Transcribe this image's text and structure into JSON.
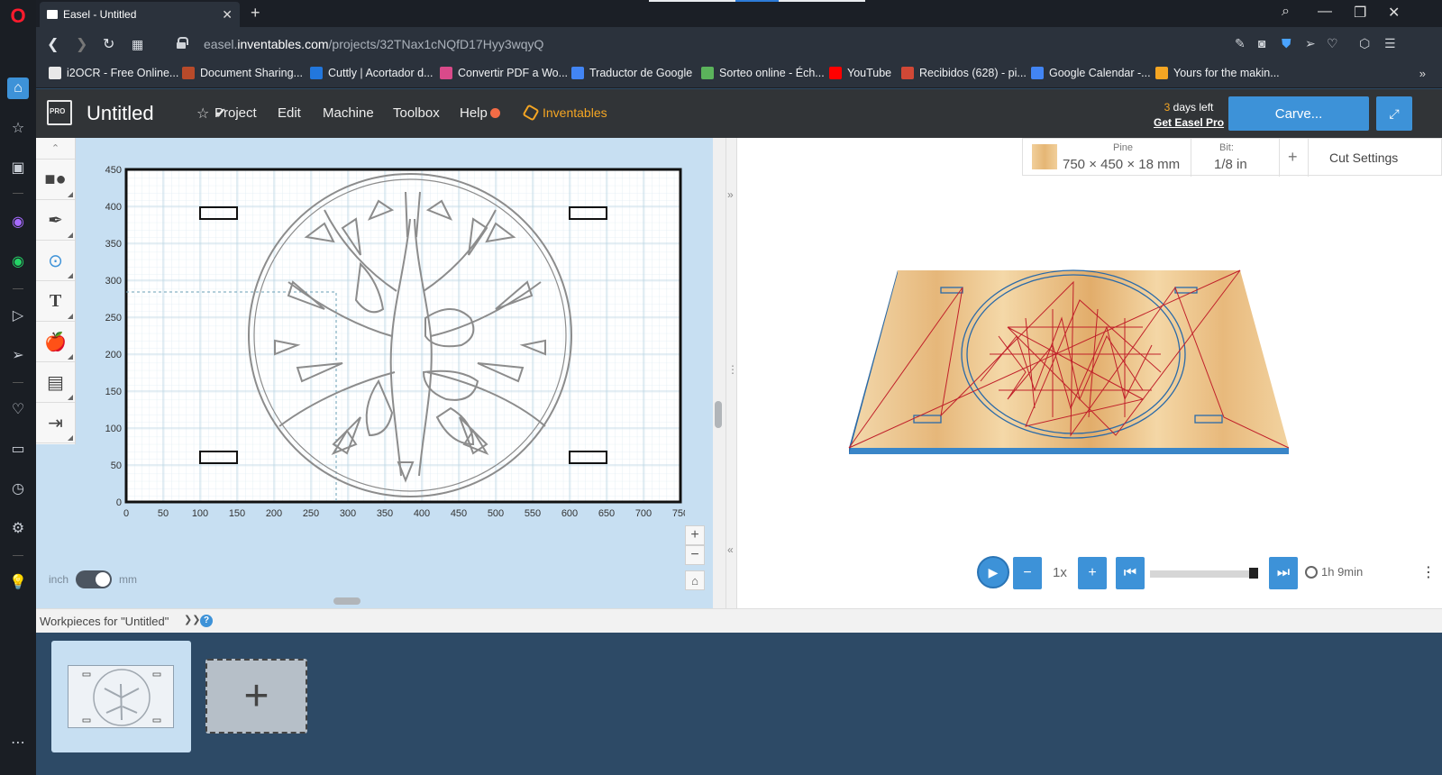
{
  "browser": {
    "tab_title": "Easel - Untitled",
    "url_prefix": "easel.",
    "url_domain": "inventables.com",
    "url_path": "/projects/32TNax1cNQfD17Hyy3wqyQ",
    "bookmarks": [
      {
        "label": "i2OCR - Free Online...",
        "color": "#e8e8e8"
      },
      {
        "label": "Document Sharing...",
        "color": "#b84a2a"
      },
      {
        "label": "Cuttly | Acortador d...",
        "color": "#2277dd"
      },
      {
        "label": "Convertir PDF a Wo...",
        "color": "#d94a8a"
      },
      {
        "label": "Traductor de Google",
        "color": "#4285f4"
      },
      {
        "label": "Sorteo online - Éch...",
        "color": "#5bb35b"
      },
      {
        "label": "YouTube",
        "color": "#ff0000"
      },
      {
        "label": "Recibidos (628) - pi...",
        "color": "#d14836"
      },
      {
        "label": "Google Calendar -...",
        "color": "#4285f4"
      },
      {
        "label": "Yours for the makin...",
        "color": "#f5a623"
      }
    ]
  },
  "easel": {
    "project_title": "Untitled",
    "menu": [
      "Project",
      "Edit",
      "Machine",
      "Toolbox",
      "Help"
    ],
    "inventables_label": "Inventables",
    "trial_days": "3",
    "trial_suffix": " days left",
    "get_pro": "Get Easel Pro",
    "carve_label": "Carve..."
  },
  "design": {
    "y_ticks": [
      "450",
      "400",
      "350",
      "300",
      "250",
      "200",
      "150",
      "100",
      "50",
      "0"
    ],
    "x_ticks": [
      "0",
      "50",
      "100",
      "150",
      "200",
      "250",
      "300",
      "350",
      "400",
      "450",
      "500",
      "550",
      "600",
      "650",
      "700",
      "750"
    ],
    "unit_left": "inch",
    "unit_right": "mm",
    "zoom_in": "+",
    "zoom_out": "−"
  },
  "material": {
    "name": "Pine",
    "dimensions": "750 × 450 × 18 mm",
    "bit_label": "Bit:",
    "bit_value": "1/8 in",
    "add": "+",
    "cut_settings": "Cut Settings"
  },
  "simulation": {
    "speed": "1x",
    "time": "1h 9min",
    "progress": 1.0
  },
  "workpieces": {
    "title": "Workpieces for \"Untitled\""
  },
  "colors": {
    "accent": "#3d92d8",
    "header_bg": "#313437",
    "canvas_bg": "#c7dff2",
    "workpieces_bg": "#2d4a66",
    "toolpath": "#c0202a"
  }
}
